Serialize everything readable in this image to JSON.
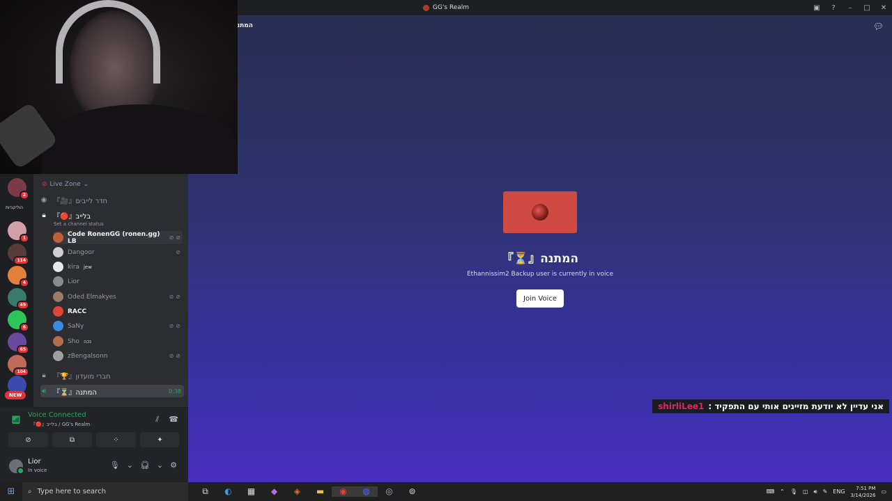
{
  "window": {
    "title": "GG's Realm"
  },
  "stage": {
    "header_title": "המתנ",
    "channel_name": "『⏳』המתנה",
    "subtitle": "Ethannissim2 Backup user is currently in voice",
    "join_label": "Join Voice"
  },
  "guilds": {
    "label": "הוליקביות",
    "badges": [
      "2",
      "1",
      "114",
      "4",
      "49",
      "6",
      "65",
      "104"
    ],
    "new_label": "NEW"
  },
  "sidebar": {
    "category": "Live Zone",
    "channels": [
      {
        "name": "『🎥』חדר לייבים"
      },
      {
        "name": "『🔴』בלייב",
        "status": "Set a channel status"
      },
      {
        "name": "『🏆』חברי מועדון"
      },
      {
        "name": "『⏳』המתנה",
        "timer": "0:38"
      }
    ],
    "members": [
      {
        "name": "Code RonenGG (ronen.gg) LB",
        "tag": "",
        "bold": true,
        "color": "#c0603a"
      },
      {
        "name": "Dangoor",
        "tag": "",
        "bold": false,
        "color": "#cfcfcf"
      },
      {
        "name": "kira",
        "tag": "jew",
        "bold": false,
        "color": "#e8e8e8"
      },
      {
        "name": "Lior",
        "tag": "",
        "bold": false,
        "color": "#8a8a8a"
      },
      {
        "name": "Oded Elmakyes",
        "tag": "",
        "bold": false,
        "color": "#9a7a6a"
      },
      {
        "name": "RACC",
        "tag": "",
        "bold": true,
        "color": "#e0453a"
      },
      {
        "name": "SaNy",
        "tag": "",
        "bold": false,
        "color": "#3a8ae0"
      },
      {
        "name": "Sho",
        "tag": "נכה",
        "bold": false,
        "color": "#b07050"
      },
      {
        "name": "zBengalsonn",
        "tag": "",
        "bold": false,
        "color": "#a0a0a0"
      }
    ]
  },
  "voice": {
    "title": "Voice Connected",
    "subtitle": "『🔴』בלייב / GG's Realm"
  },
  "user": {
    "name": "Lior",
    "status": "In voice"
  },
  "overlay": {
    "user": "shirliLee1",
    "message": "אני עדיין לא יודעת מזיינים אותי עם התפקיד :"
  },
  "taskbar": {
    "search_placeholder": "Type here to search",
    "lang": "ENG",
    "time": "7:51 PM",
    "date": "3/14/2026"
  },
  "colors": {
    "accent_green": "#23a55a",
    "stage_bg": "#3a32a8",
    "card_red": "#d04a44"
  }
}
